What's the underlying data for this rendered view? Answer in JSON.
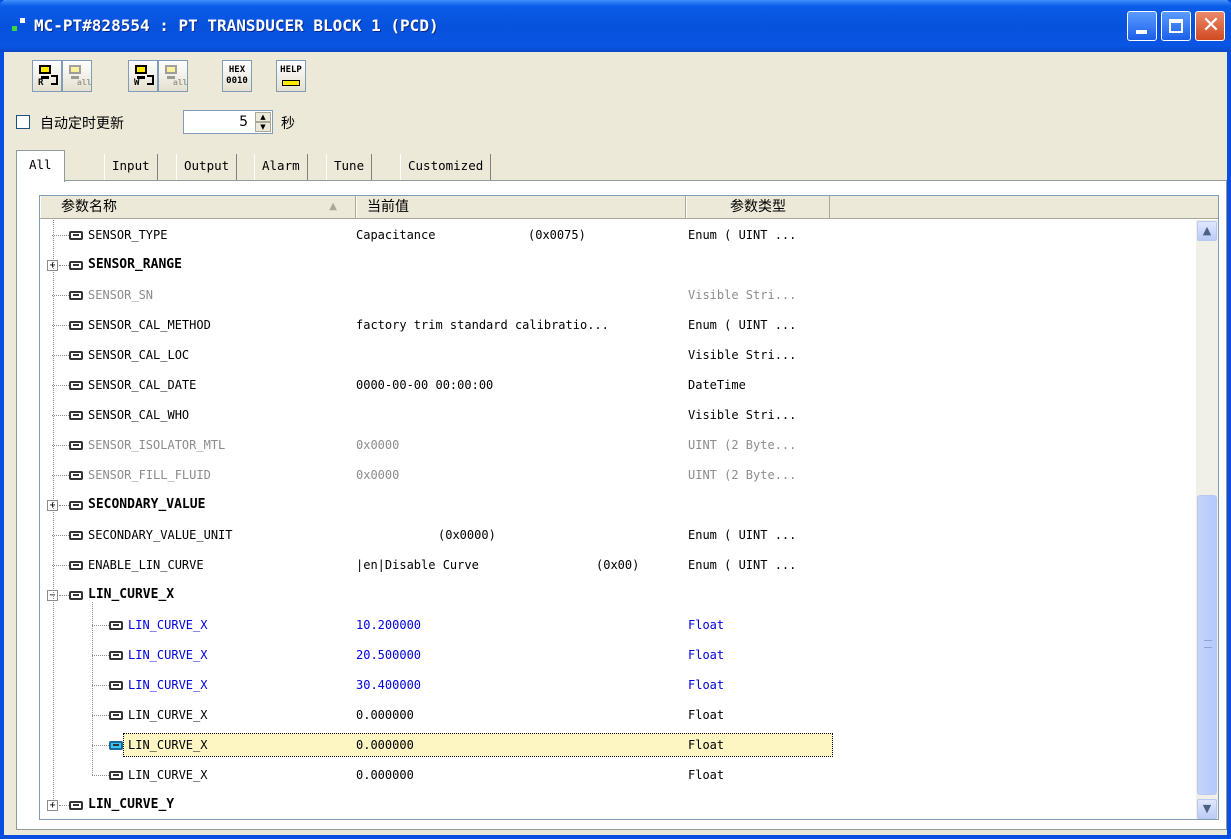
{
  "window": {
    "title": "MC-PT#828554 : PT TRANSDUCER BLOCK 1 (PCD)"
  },
  "toolbar": {
    "buttons": [
      {
        "label": "R",
        "icon": "read-device-icon",
        "enabled": true
      },
      {
        "label": "all",
        "icon": "read-all-icon",
        "enabled": false
      },
      {
        "label": "W",
        "icon": "write-device-icon",
        "enabled": true
      },
      {
        "label": "all",
        "icon": "write-all-icon",
        "enabled": false
      },
      {
        "label": "HEX 0010",
        "icon": "hex-toggle-icon",
        "enabled": true
      },
      {
        "label": "HELP",
        "icon": "help-icon",
        "enabled": true
      }
    ],
    "hex_top": "HEX",
    "hex_bottom": "0010",
    "help_label": "HELP"
  },
  "auto_update": {
    "label": "自动定时更新",
    "checked": false,
    "interval": "5",
    "unit": "秒"
  },
  "tabs": [
    {
      "label": "All",
      "active": true
    },
    {
      "label": "Input",
      "active": false
    },
    {
      "label": "Output",
      "active": false
    },
    {
      "label": "Alarm",
      "active": false
    },
    {
      "label": "Tune",
      "active": false
    },
    {
      "label": "Customized",
      "active": false
    }
  ],
  "grid": {
    "columns": {
      "name": "参数名称",
      "value": "当前值",
      "type": "参数类型"
    },
    "rows": [
      {
        "name": "SENSOR_TYPE",
        "value": "Capacitance",
        "hex": "(0x0075)",
        "type": "Enum ( UINT ...",
        "style": "normal",
        "level": 0,
        "expander": ""
      },
      {
        "name": "SENSOR_RANGE",
        "value": "",
        "hex": "",
        "type": "",
        "style": "bold",
        "level": 0,
        "expander": "+"
      },
      {
        "name": "SENSOR_SN",
        "value": "",
        "hex": "",
        "type": "Visible Stri...",
        "style": "gray",
        "level": 0,
        "expander": ""
      },
      {
        "name": "SENSOR_CAL_METHOD",
        "value": "factory trim standard calibratio...",
        "hex": "",
        "type": "Enum ( UINT ...",
        "style": "normal",
        "level": 0,
        "expander": ""
      },
      {
        "name": "SENSOR_CAL_LOC",
        "value": "",
        "hex": "",
        "type": "Visible Stri...",
        "style": "normal",
        "level": 0,
        "expander": ""
      },
      {
        "name": "SENSOR_CAL_DATE",
        "value": "0000-00-00 00:00:00",
        "hex": "",
        "type": "DateTime",
        "style": "normal",
        "level": 0,
        "expander": ""
      },
      {
        "name": "SENSOR_CAL_WHO",
        "value": "",
        "hex": "",
        "type": "Visible Stri...",
        "style": "normal",
        "level": 0,
        "expander": ""
      },
      {
        "name": "SENSOR_ISOLATOR_MTL",
        "value": "0x0000",
        "hex": "",
        "type": "UINT (2 Byte...",
        "style": "gray",
        "level": 0,
        "expander": ""
      },
      {
        "name": "SENSOR_FILL_FLUID",
        "value": "0x0000",
        "hex": "",
        "type": "UINT (2 Byte...",
        "style": "gray",
        "level": 0,
        "expander": ""
      },
      {
        "name": "SECONDARY_VALUE",
        "value": "",
        "hex": "",
        "type": "",
        "style": "bold",
        "level": 0,
        "expander": "+"
      },
      {
        "name": "SECONDARY_VALUE_UNIT",
        "value": "",
        "hex": "(0x0000)",
        "type": "Enum ( UINT ...",
        "style": "normal",
        "level": 0,
        "expander": ""
      },
      {
        "name": "ENABLE_LIN_CURVE",
        "value": "|en|Disable Curve",
        "hex": "(0x00)",
        "type": "Enum ( UINT ...",
        "style": "normal",
        "level": 0,
        "expander": ""
      },
      {
        "name": "LIN_CURVE_X",
        "value": "",
        "hex": "",
        "type": "",
        "style": "bold",
        "level": 0,
        "expander": "-"
      },
      {
        "name": "LIN_CURVE_X",
        "value": "10.200000",
        "hex": "",
        "type": "Float",
        "style": "blue",
        "level": 1,
        "expander": ""
      },
      {
        "name": "LIN_CURVE_X",
        "value": "20.500000",
        "hex": "",
        "type": "Float",
        "style": "blue",
        "level": 1,
        "expander": ""
      },
      {
        "name": "LIN_CURVE_X",
        "value": "30.400000",
        "hex": "",
        "type": "Float",
        "style": "blue",
        "level": 1,
        "expander": ""
      },
      {
        "name": "LIN_CURVE_X",
        "value": "0.000000",
        "hex": "",
        "type": "Float",
        "style": "normal",
        "level": 1,
        "expander": ""
      },
      {
        "name": "LIN_CURVE_X",
        "value": "0.000000",
        "hex": "",
        "type": "Float",
        "style": "selected",
        "level": 1,
        "expander": ""
      },
      {
        "name": "LIN_CURVE_X",
        "value": "0.000000",
        "hex": "",
        "type": "Float",
        "style": "normal",
        "level": 1,
        "expander": ""
      },
      {
        "name": "LIN_CURVE_Y",
        "value": "",
        "hex": "",
        "type": "",
        "style": "bold",
        "level": 0,
        "expander": "+"
      }
    ]
  },
  "colors": {
    "titlebar": "#0652dd",
    "selected_row": "#fdf5c2",
    "blue_text": "#0000e0",
    "gray_text": "#8c8c8c"
  }
}
